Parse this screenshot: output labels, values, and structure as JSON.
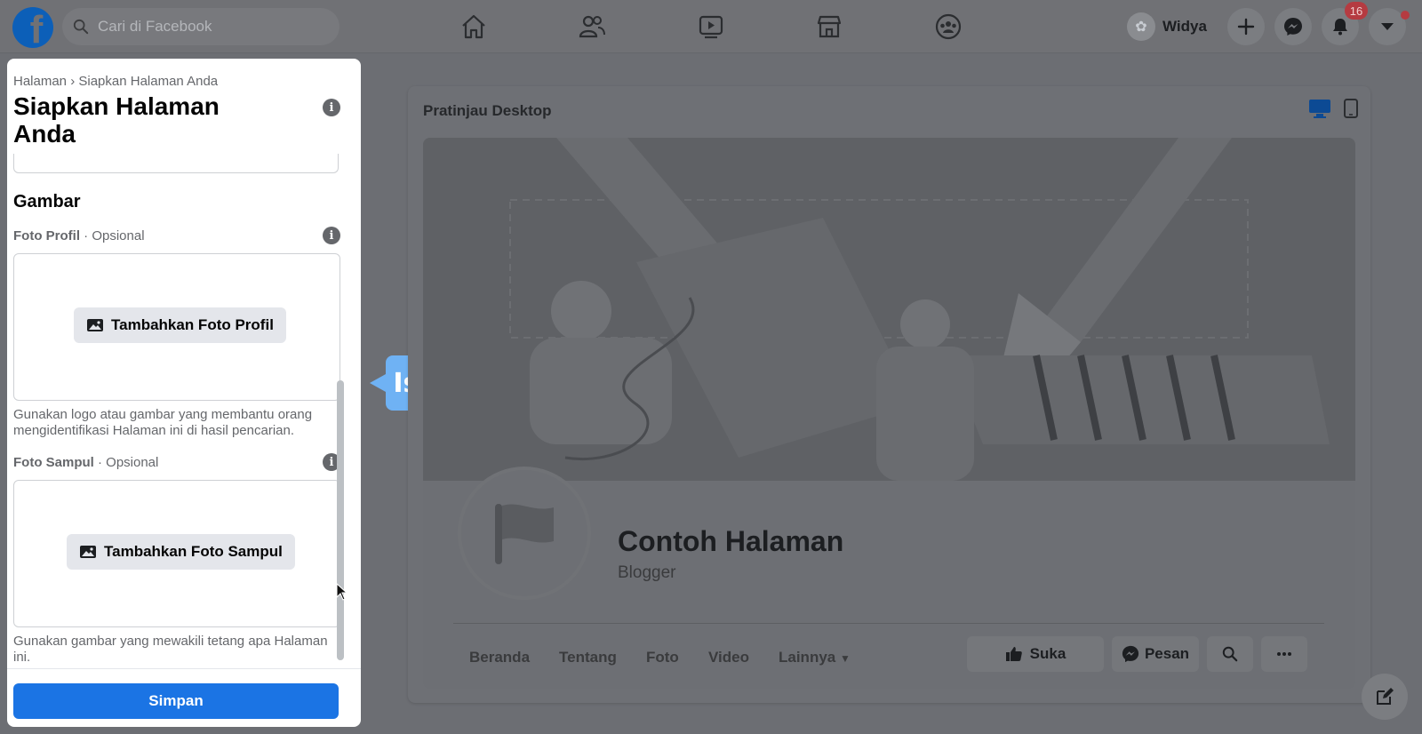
{
  "topbar": {
    "logo_letter": "f",
    "search_placeholder": "Cari di Facebook",
    "user_name": "Widya",
    "notification_count": "16",
    "nav_icons": [
      "home-icon",
      "friends-icon",
      "watch-icon",
      "marketplace-icon",
      "groups-icon"
    ]
  },
  "panel": {
    "breadcrumb": "Halaman › Siapkan Halaman Anda",
    "title": "Siapkan Halaman Anda",
    "section_title": "Gambar",
    "profile_label": "Foto Profil",
    "profile_optional": " · Opsional",
    "profile_button": "Tambahkan Foto Profil",
    "profile_hint": "Gunakan logo atau gambar yang membantu orang mengidentifikasi Halaman ini di hasil pencarian.",
    "cover_label": "Foto Sampul",
    "cover_optional": " · Opsional",
    "cover_button": "Tambahkan Foto Sampul",
    "cover_hint": "Gunakan gambar yang mewakili tetang apa Halaman ini.",
    "save_button": "Simpan",
    "info_glyph": "i"
  },
  "tooltip": {
    "text": "Isi disini"
  },
  "preview": {
    "header": "Pratinjau Desktop",
    "page_name": "Contoh Halaman",
    "page_category": "Blogger",
    "tabs": [
      "Beranda",
      "Tentang",
      "Foto",
      "Video",
      "Lainnya"
    ],
    "like_button": "Suka",
    "message_button": "Pesan"
  },
  "colors": {
    "brand_blue": "#1b74e4",
    "tooltip_blue": "#6fb2f4",
    "overlay_gray": "#6c6e73",
    "badge_red": "#b53b41"
  }
}
